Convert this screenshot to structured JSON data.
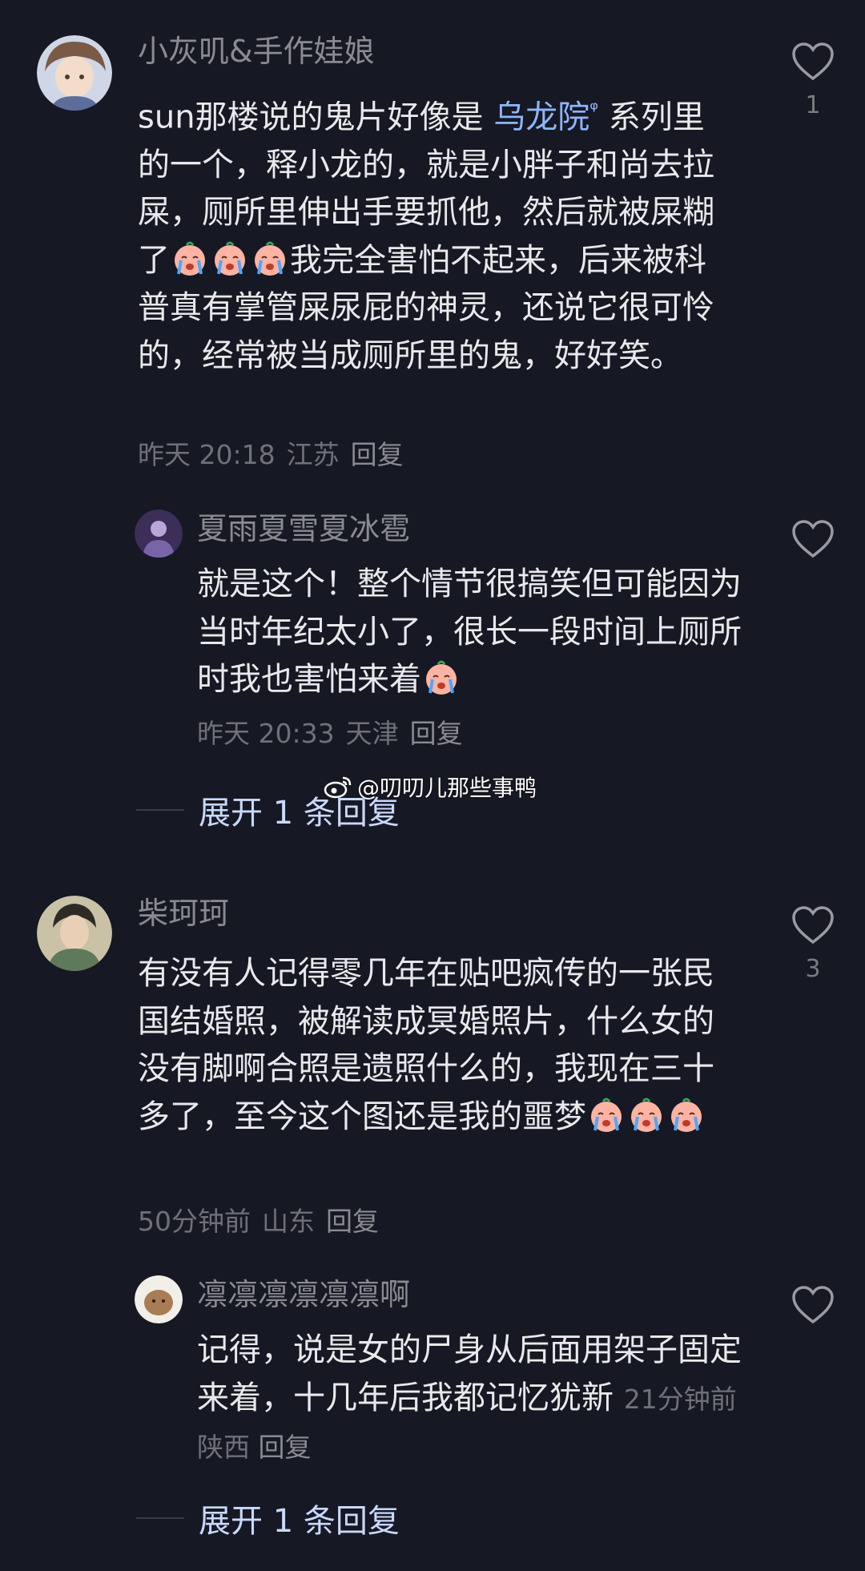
{
  "comments": [
    {
      "username": "小灰叽&手作娃娘",
      "text_before_link": "sun那楼说的鬼片好像是 ",
      "link": "乌龙院",
      "link_mark": "ᵠ",
      "text_after_link": " 系列里的一个，释小龙的，就是小胖子和尚去拉屎，厕所里伸出手要抓他，然后就被屎糊了",
      "text_after_emoji": "我完全害怕不起来，后来被科普真有掌管屎尿屁的神灵，还说它很可怜的，经常被当成厕所里的鬼，好好笑。",
      "time": "昨天 20:18",
      "location": "江苏",
      "reply": "回复",
      "likes": "1",
      "emoji": "crying-face-icon"
    },
    {
      "username": "夏雨夏雪夏冰雹",
      "text": "就是这个！整个情节很搞笑但可能因为当时年纪太小了，很长一段时间上厕所时我也害怕来着",
      "time": "昨天 20:33",
      "location": "天津",
      "reply": "回复",
      "expand": "展开 1 条回复"
    },
    {
      "username": "柴珂珂",
      "text": "有没有人记得零几年在贴吧疯传的一张民国结婚照，被解读成冥婚照片，什么女的没有脚啊合照是遗照什么的，我现在三十多了，至今这个图还是我的噩梦",
      "time": "50分钟前",
      "location": "山东",
      "reply": "回复",
      "likes": "3"
    },
    {
      "username": "凛凛凛凛凛凛啊",
      "text": "记得，说是女的尸身从后面用架子固定来着，十几年后我都记忆犹新",
      "time": "21分钟前",
      "location": "陕西",
      "reply": "回复",
      "expand": "展开 1 条回复"
    }
  ],
  "watermark": "@叨叨儿那些事鸭",
  "colors": {
    "background": "#161823",
    "username": "#8a8b91",
    "link": "#8fb6ff"
  }
}
